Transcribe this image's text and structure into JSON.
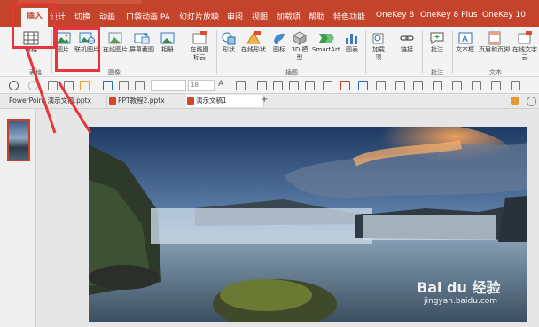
{
  "tabs": [
    "插入",
    "设计",
    "切换",
    "动画",
    "口袋动画 PA",
    "幻灯片放映",
    "审阅",
    "视图",
    "加载项",
    "帮助",
    "特色功能",
    "OneKey 8",
    "OneKey 8 Plus",
    "OneKey 10"
  ],
  "ribbon": {
    "table_label": "表格",
    "picture_label": "图片",
    "online_picture_label": "联机图片",
    "online_picture2_label": "在线图片",
    "screenshot_label": "屏幕截图",
    "album_label": "相册",
    "online_icons_label": "在线图标云",
    "shapes_label": "形状",
    "online_shapes_label": "在线形状",
    "icons_label": "图标",
    "model3d_label": "3D 模型",
    "smartart_label": "SmartArt",
    "chart_label": "图表",
    "addin_label": "加载项",
    "link_label": "链接",
    "comment_label": "批注",
    "textbox_label": "文本框",
    "header_footer_label": "页眉和页脚",
    "online_text_label": "在线文字云",
    "group_tables": "表格",
    "group_images": "图像",
    "group_illustrations": "插图",
    "group_comments": "批注",
    "group_text": "文本"
  },
  "quick_toolbar": {
    "font_size": "18"
  },
  "doc_tabs": [
    {
      "label": "PowerPoint 演示文稿.pptx"
    },
    {
      "label": "PPT教程2.pptx"
    },
    {
      "label": "演示文稿1"
    }
  ],
  "new_tab_symbol": "+",
  "watermark": {
    "logo": "Bai du 经验",
    "url": "jingyan.baidu.com"
  },
  "colors": {
    "accent": "#c4432b",
    "highlight": "#e8343a"
  }
}
